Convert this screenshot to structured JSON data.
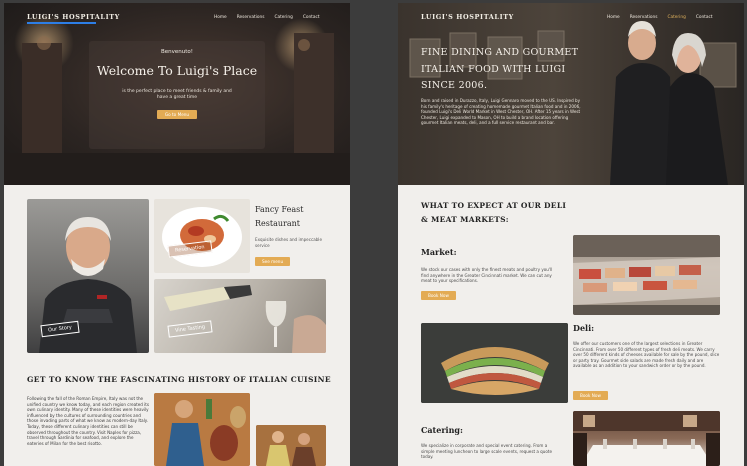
{
  "home_page": {
    "logo": "LUIGI'S HOSPITALITY",
    "nav": [
      "Home",
      "Reservations",
      "Catering",
      "Contact"
    ],
    "hero": {
      "welcome": "Benvenuto!",
      "title": "Welcome To Luigi's Place",
      "subtitle": "is the perfect place to meet friends & family and have a great time",
      "button": "Go to Menu"
    },
    "cards": {
      "story_label": "Our Story",
      "reservation_label": "Reservation",
      "wine_label": "Vine Tasting"
    },
    "fancy": {
      "title": "Fancy Feast Restaurant",
      "text": "Exquisite dishes and impeccable service",
      "button": "See menu"
    },
    "history": {
      "title": "GET TO KNOW THE FASCINATING HISTORY OF ITALIAN CUISINE",
      "text": "Following the fall of the Roman Empire, Italy was not the unified country we know today, and each region created its own culinary identity. Many of these identities were heavily influenced by the cultures of surrounding countries and those invading parts of what we know as modern-day Italy. Today, these different culinary identities can still be observed throughout the country. Visit Naples for pizza, travel through Sardinia for seafood, and explore the eateries of Milan for the best risotto."
    }
  },
  "deli_page": {
    "logo": "LUIGI'S HOSPITALITY",
    "nav": [
      "Home",
      "Reservations",
      "Catering",
      "Contact"
    ],
    "hero": {
      "title": "FINE DINING AND GOURMET ITALIAN FOOD WITH LUIGI SINCE 2006.",
      "text": "Born and raised in Durazzo, Italy, Luigi Gennaro moved to the US. Inspired by his family's heritage of creating homemade gourmet Italian food and in 2006, founded Luigi's Deli World Market in West Chester, OH. After 15 years in West Chester, Luigi expanded to Mason, OH to build a brand location offering gourmet Italian meats, deli, and a full service restaurant and bar."
    },
    "expect_title": "WHAT TO EXPECT AT OUR DELI & MEAT MARKETS:",
    "market": {
      "title": "Market:",
      "text": "We stock our cases with only the finest meats and poultry you'll find anywhere in the Greater Cincinnati market. We can cut any meat to your specifications.",
      "button": "Book Now"
    },
    "deli": {
      "title": "Deli:",
      "text": "We offer our customers one of the largest selections in Greater Cincinnati. From over 50 different types of fresh deli meats. We carry over 50 different kinds of cheeses available for sale by the pound, slice or party tray. Gourmet side salads are made fresh daily and are available as an addition to your sandwich order or by the pound.",
      "button": "Book Now"
    },
    "catering": {
      "title": "Catering:",
      "text": "We specialize in corporate and special event catering. From a simple meeting luncheon to large scale events, request a quote today."
    }
  },
  "colors": {
    "accent_gold": "#e3ab54",
    "logo_underline": "#2d7ee6",
    "section_bg": "#f1efec"
  }
}
